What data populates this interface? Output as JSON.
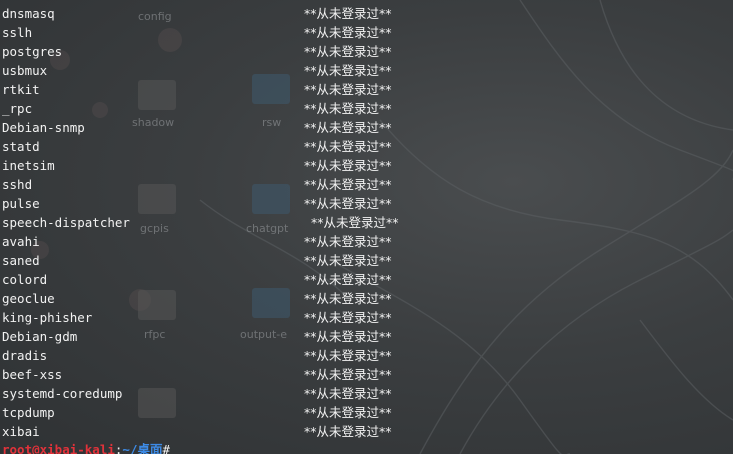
{
  "terminal": {
    "entries": [
      {
        "user": "dnsmasq",
        "status": "**从未登录过**"
      },
      {
        "user": "sslh",
        "status": "**从未登录过**"
      },
      {
        "user": "postgres",
        "status": "**从未登录过**"
      },
      {
        "user": "usbmux",
        "status": "**从未登录过**"
      },
      {
        "user": "rtkit",
        "status": "**从未登录过**"
      },
      {
        "user": "_rpc",
        "status": "**从未登录过**"
      },
      {
        "user": "Debian-snmp",
        "status": "**从未登录过**"
      },
      {
        "user": "statd",
        "status": "**从未登录过**"
      },
      {
        "user": "inetsim",
        "status": "**从未登录过**"
      },
      {
        "user": "sshd",
        "status": "**从未登录过**"
      },
      {
        "user": "pulse",
        "status": "**从未登录过**"
      },
      {
        "user": "speech-dispatcher",
        "status": "**从未登录过**"
      },
      {
        "user": "avahi",
        "status": "**从未登录过**"
      },
      {
        "user": "saned",
        "status": "**从未登录过**"
      },
      {
        "user": "colord",
        "status": "**从未登录过**"
      },
      {
        "user": "geoclue",
        "status": "**从未登录过**"
      },
      {
        "user": "king-phisher",
        "status": "**从未登录过**"
      },
      {
        "user": "Debian-gdm",
        "status": "**从未登录过**"
      },
      {
        "user": "dradis",
        "status": "**从未登录过**"
      },
      {
        "user": "beef-xss",
        "status": "**从未登录过**"
      },
      {
        "user": "systemd-coredump",
        "status": "**从未登录过**"
      },
      {
        "user": "tcpdump",
        "status": "**从未登录过**"
      },
      {
        "user": "xibai",
        "status": "**从未登录过**"
      }
    ],
    "prompt": {
      "user_host": "root@xibai-kali",
      "colon": ":",
      "path": "~/桌面",
      "symbol": "#"
    }
  },
  "desktop": {
    "labels": {
      "icon_1": "config",
      "icon_2": "shadow",
      "icon_3": "rsw",
      "icon_4": "gcpis",
      "icon_5": "chatgpt",
      "icon_6": "rfpc",
      "icon_7": "output-e"
    }
  },
  "colors": {
    "prompt_user": "#e0323a",
    "prompt_path": "#3d8be6",
    "text": "#f2f2f2"
  }
}
